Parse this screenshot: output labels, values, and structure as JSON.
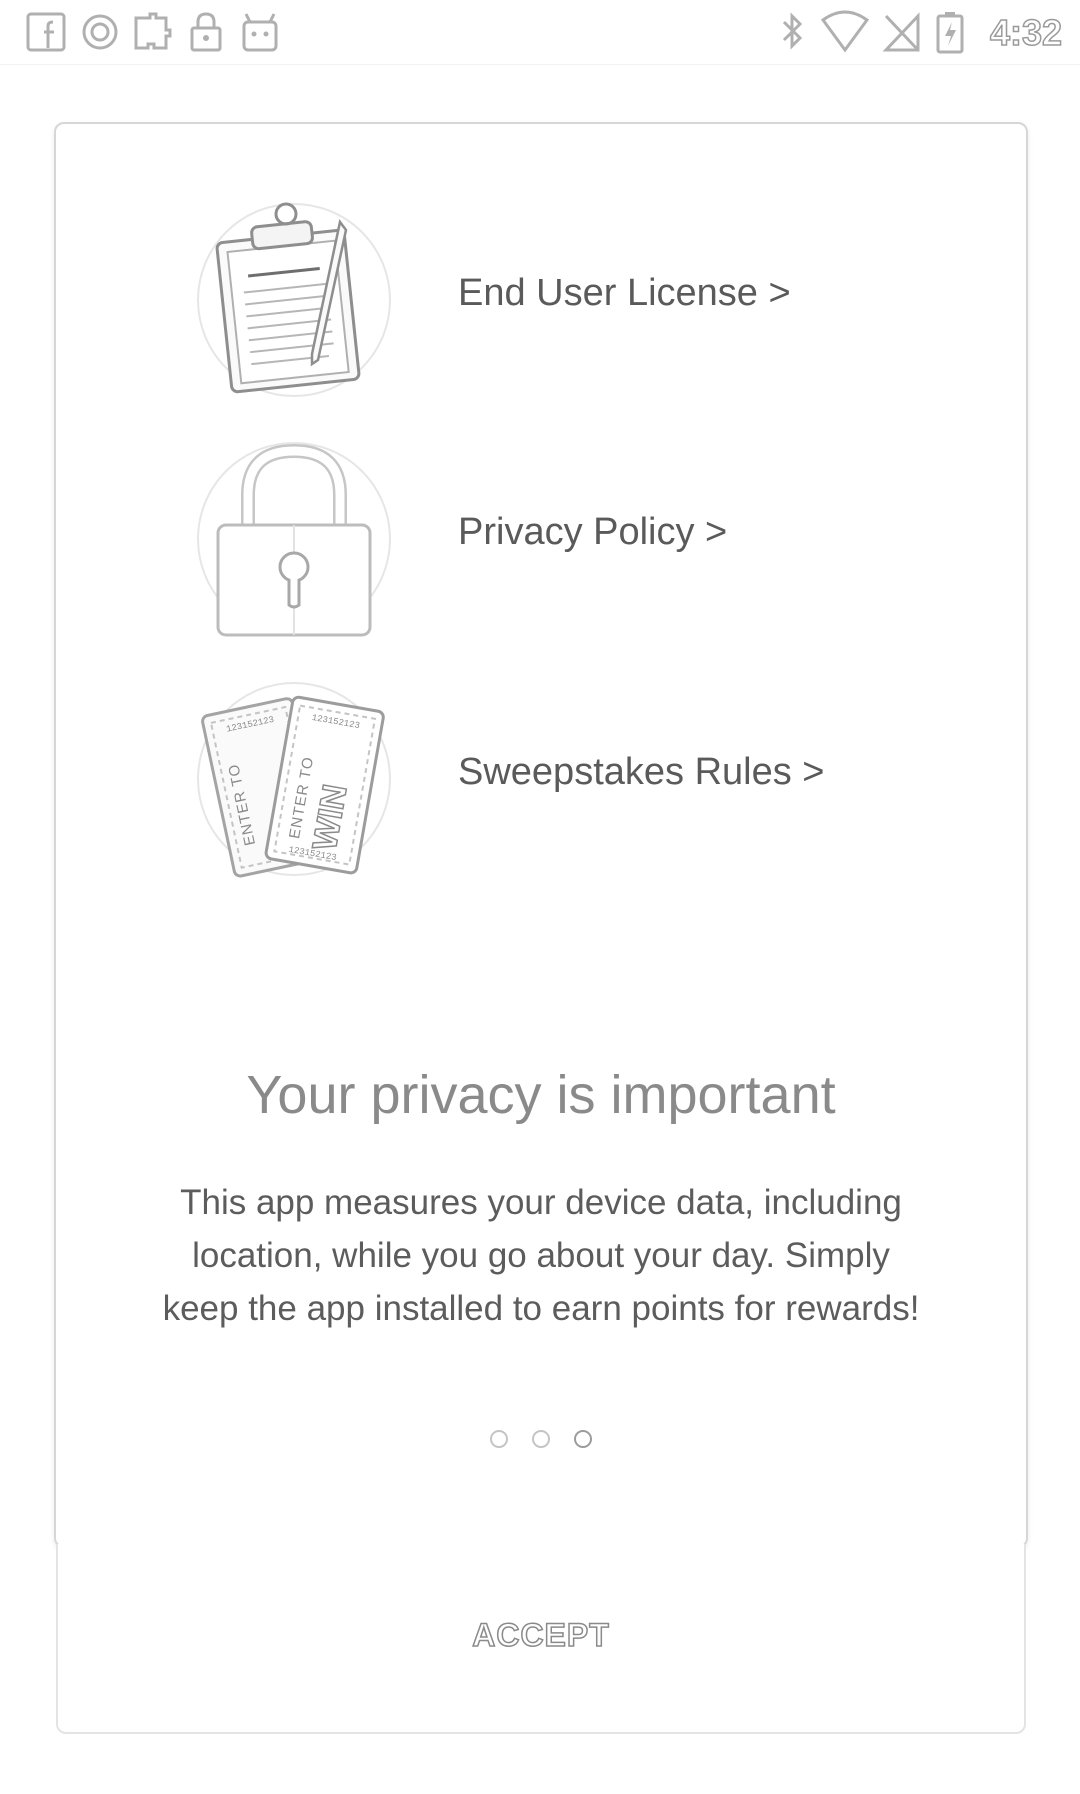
{
  "status_bar": {
    "left_icons": [
      "facebook-icon",
      "circle-o-icon",
      "puzzle-icon",
      "lock-icon",
      "android-icon"
    ],
    "right_icons": [
      "bluetooth-icon",
      "wifi-icon",
      "no-signal-icon",
      "battery-charging-icon"
    ],
    "time": "4:32"
  },
  "links": [
    {
      "label": "End User License >",
      "icon": "clipboard-icon"
    },
    {
      "label": "Privacy Policy >",
      "icon": "padlock-icon"
    },
    {
      "label": "Sweepstakes Rules >",
      "icon": "tickets-icon"
    }
  ],
  "tickets": {
    "serial": "123152123",
    "line1": "ENTER TO",
    "line2": "WIN"
  },
  "headline": "Your privacy is important",
  "body": "This app measures your device data, including location, while you go about your day. Simply keep the app installed to earn points for rewards!",
  "pager": {
    "count": 3,
    "active_index": 2
  },
  "accept_label": "ACCEPT",
  "colors": {
    "line": "#d0d0d0",
    "text": "#5a5a5a",
    "headline": "#8a8a8a"
  }
}
